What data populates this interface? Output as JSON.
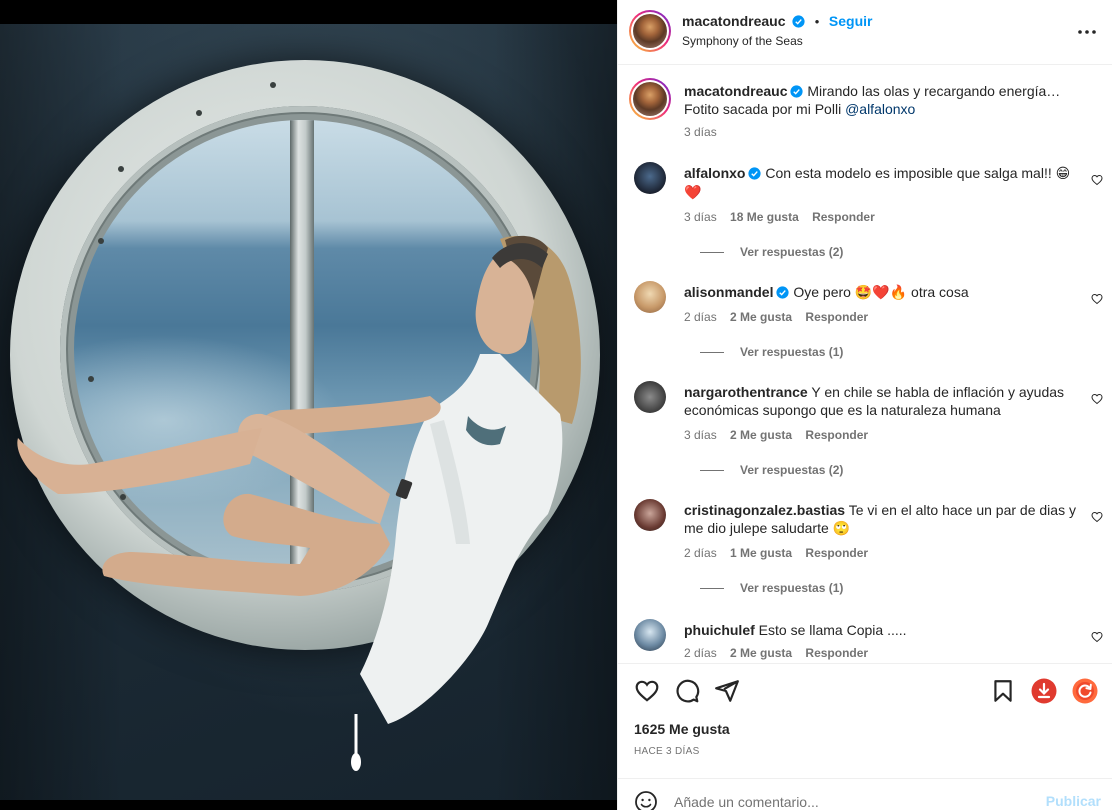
{
  "post": {
    "username": "macatondreauc",
    "follow_label": "Seguir",
    "location": "Symphony of the Seas",
    "caption_line1": "Mirando las olas y recargando energía…",
    "caption_line2_text": "Fotito sacada por mi Polli ",
    "caption_mention": "@alfalonxo",
    "caption_age": "3 días"
  },
  "comments": [
    {
      "username": "alfalonxo",
      "verified": true,
      "text": "Con esta modelo es imposible que salga mal!! ",
      "emojis": "😁 ❤️",
      "age": "3 días",
      "likes": "18 Me gusta",
      "reply_label": "Responder",
      "replies": "Ver respuestas (2)"
    },
    {
      "username": "alisonmandel",
      "verified": true,
      "text": "Oye pero ",
      "emojis": "🤩❤️🔥",
      "text_after": " otra cosa",
      "age": "2 días",
      "likes": "2 Me gusta",
      "reply_label": "Responder",
      "replies": "Ver respuestas (1)"
    },
    {
      "username": "nargarothentrance",
      "verified": false,
      "text": "Y en chile se habla de inflación y ayudas económicas supongo que es la naturaleza humana",
      "age": "3 días",
      "likes": "2 Me gusta",
      "reply_label": "Responder",
      "replies": "Ver respuestas (2)"
    },
    {
      "username": "cristinagonzalez.bastias",
      "verified": false,
      "text": "Te vi en el alto hace un par de dias y me dio julepe saludarte ",
      "emojis": "🙄",
      "age": "2 días",
      "likes": "1 Me gusta",
      "reply_label": "Responder",
      "replies": "Ver respuestas (1)"
    },
    {
      "username": "phuichulef",
      "verified": false,
      "text": "Esto se llama Copia .....",
      "age": "2 días",
      "likes": "2 Me gusta",
      "reply_label": "Responder"
    }
  ],
  "footer": {
    "likes_count": "1625 Me gusta",
    "date": "HACE 3 DÍAS",
    "comment_placeholder": "Añade un comentario...",
    "publish_label": "Publicar"
  },
  "colors": {
    "link_blue": "#0095f6",
    "verified_blue": "#0095f6",
    "like_red": "#ed4956",
    "download_red": "#e03a2f"
  },
  "icons": [
    "more-icon",
    "heart-icon",
    "comment-icon",
    "share-icon",
    "bookmark-icon",
    "download-icon",
    "refresh-icon",
    "emoji-icon",
    "verified-icon"
  ]
}
